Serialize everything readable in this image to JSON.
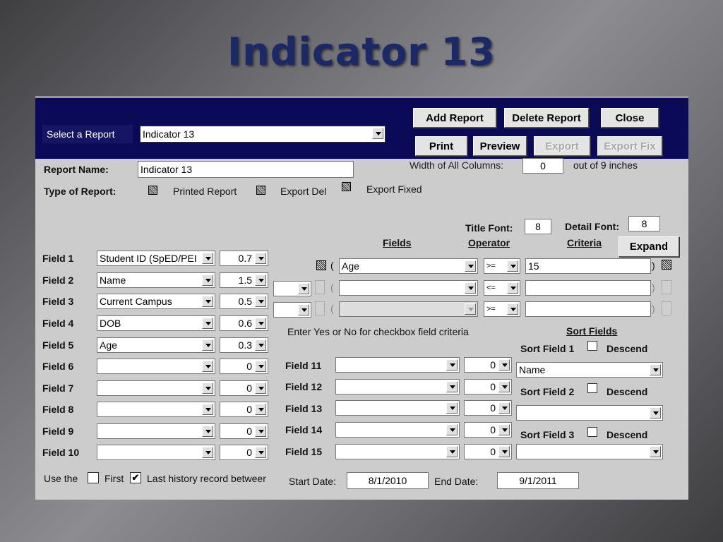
{
  "slide_title": "Indicator 13",
  "header": {
    "select_report_label": "Select a Report",
    "select_report_value": "Indicator 13",
    "buttons": {
      "add_report": "Add Report",
      "delete_report": "Delete Report",
      "close": "Close",
      "print": "Print",
      "preview": "Preview",
      "export": "Export",
      "export_fix": "Export Fix"
    }
  },
  "report": {
    "name_label": "Report Name:",
    "name_value": "Indicator 13",
    "width_label": "Width of All Columns:",
    "width_value": "0",
    "width_suffix": "out of 9 inches",
    "type_label": "Type of Report:",
    "type_options": [
      "Printed Report",
      "Export Del",
      "Export Fixed"
    ]
  },
  "fonts": {
    "title_label": "Title Font:",
    "title_value": "8",
    "detail_label": "Detail Font:",
    "detail_value": "8",
    "expand_label": "Expand"
  },
  "criteria_headers": {
    "fields": "Fields",
    "operator": "Operator",
    "criteria": "Criteria"
  },
  "criteria_rows": [
    {
      "open_paren": "(",
      "field": "Age",
      "operator": ">=",
      "value": "15",
      "close_paren": ")"
    },
    {
      "open_paren": "(",
      "field": "",
      "operator": "<=",
      "value": "",
      "close_paren": ")"
    },
    {
      "open_paren": "(",
      "field": "",
      "operator": ">=",
      "value": "",
      "close_paren": ")"
    }
  ],
  "checkbox_hint": "Enter Yes or No for checkbox field criteria",
  "fields_left": [
    {
      "label": "Field 1",
      "value": "Student ID (SpED/PEI",
      "width": "0.7"
    },
    {
      "label": "Field 2",
      "value": "Name",
      "width": "1.5"
    },
    {
      "label": "Field 3",
      "value": "Current Campus",
      "width": "0.5"
    },
    {
      "label": "Field 4",
      "value": "DOB",
      "width": "0.6"
    },
    {
      "label": "Field 5",
      "value": "Age",
      "width": "0.3"
    },
    {
      "label": "Field 6",
      "value": "",
      "width": "0"
    },
    {
      "label": "Field 7",
      "value": "",
      "width": "0"
    },
    {
      "label": "Field 8",
      "value": "",
      "width": "0"
    },
    {
      "label": "Field 9",
      "value": "",
      "width": "0"
    },
    {
      "label": "Field 10",
      "value": "",
      "width": "0"
    }
  ],
  "fields_right": [
    {
      "label": "Field 11",
      "value": "",
      "width": "0"
    },
    {
      "label": "Field 12",
      "value": "",
      "width": "0"
    },
    {
      "label": "Field 13",
      "value": "",
      "width": "0"
    },
    {
      "label": "Field 14",
      "value": "",
      "width": "0"
    },
    {
      "label": "Field 15",
      "value": "",
      "width": "0"
    }
  ],
  "sort": {
    "heading": "Sort Fields",
    "descend_label": "Descend",
    "items": [
      {
        "label": "Sort Field 1",
        "value": "Name"
      },
      {
        "label": "Sort Field 2",
        "value": ""
      },
      {
        "label": "Sort Field 3",
        "value": ""
      }
    ]
  },
  "history": {
    "prefix": "Use the",
    "first_label": "First",
    "last_label": "Last history record betweer",
    "last_checked_mark": "✔",
    "start_label": "Start Date:",
    "start_value": "8/1/2010",
    "end_label": "End Date:",
    "end_value": "9/1/2011"
  }
}
